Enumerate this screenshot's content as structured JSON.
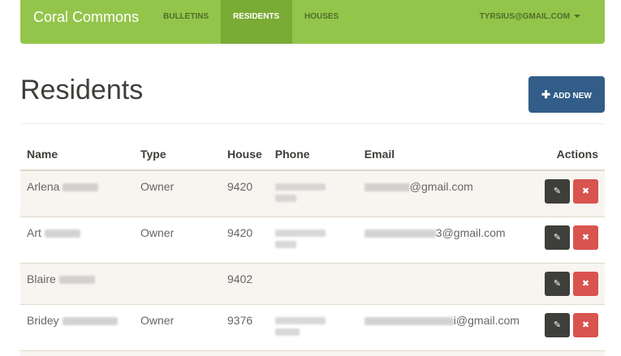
{
  "navbar": {
    "brand": "Coral Commons",
    "items": [
      {
        "label": "BULLETINS"
      },
      {
        "label": "RESIDENTS"
      },
      {
        "label": "HOUSES"
      }
    ],
    "user": "TYRSIUS@GMAIL.COM"
  },
  "page": {
    "title": "Residents",
    "add_button": "ADD NEW"
  },
  "table": {
    "headers": [
      "Name",
      "Type",
      "House",
      "Phone",
      "Email",
      "Actions"
    ],
    "rows": [
      {
        "first": "Arlena",
        "type": "Owner",
        "house": "9420",
        "email_suffix": "@gmail.com"
      },
      {
        "first": "Art",
        "type": "Owner",
        "house": "9420",
        "email_suffix": "3@gmail.com"
      },
      {
        "first": "Blaire",
        "type": "",
        "house": "9402",
        "email_suffix": ""
      },
      {
        "first": "Bridey",
        "type": "Owner",
        "house": "9376",
        "email_suffix": "i@gmail.com"
      }
    ]
  },
  "icons": {
    "edit": "edit-icon",
    "delete": "close-icon",
    "add": "plus-icon"
  },
  "colors": {
    "navbar": "#93c54b",
    "navbar_active": "#7aab35",
    "primary": "#325d88",
    "danger": "#d9534f",
    "dark": "#3e3f3a",
    "stripe": "#f8f5f0"
  }
}
